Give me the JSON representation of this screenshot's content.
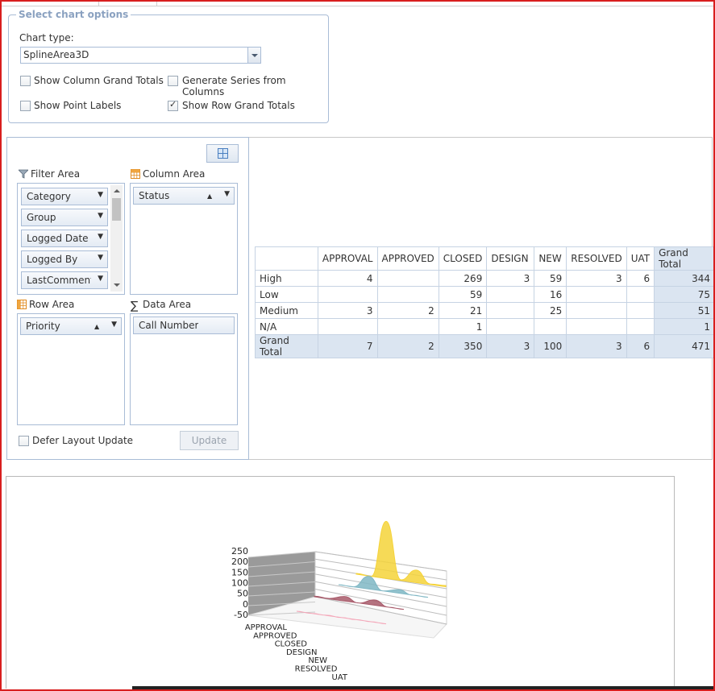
{
  "chart_options": {
    "legend": "Select chart options",
    "chart_type_label": "Chart type:",
    "chart_type_value": "SplineArea3D",
    "checkboxes": [
      {
        "label": "Show Column Grand Totals",
        "checked": false
      },
      {
        "label": "Generate Series from Columns",
        "checked": false
      },
      {
        "label": "Show Point Labels",
        "checked": false
      },
      {
        "label": "Show Row Grand Totals",
        "checked": true
      }
    ]
  },
  "field_list": {
    "filter_area": {
      "title": "Filter Area",
      "fields": [
        "Category",
        "Group",
        "Logged Date",
        "Logged By",
        "LastCommentT"
      ]
    },
    "column_area": {
      "title": "Column Area",
      "fields": [
        "Status"
      ]
    },
    "row_area": {
      "title": "Row Area",
      "fields": [
        "Priority"
      ]
    },
    "data_area": {
      "title": "Data Area",
      "fields": [
        "Call Number"
      ]
    },
    "defer_label": "Defer Layout Update",
    "update_label": "Update"
  },
  "pivot": {
    "columns": [
      "APPROVAL",
      "APPROVED",
      "CLOSED",
      "DESIGN",
      "NEW",
      "RESOLVED",
      "UAT",
      "Grand Total"
    ],
    "rows": [
      {
        "label": "High",
        "cells": [
          "4",
          "",
          "269",
          "3",
          "59",
          "3",
          "6",
          "344"
        ]
      },
      {
        "label": "Low",
        "cells": [
          "",
          "",
          "59",
          "",
          "16",
          "",
          "",
          "75"
        ]
      },
      {
        "label": "Medium",
        "cells": [
          "3",
          "2",
          "21",
          "",
          "25",
          "",
          "",
          "51"
        ]
      },
      {
        "label": "N/A",
        "cells": [
          "",
          "",
          "1",
          "",
          "",
          "",
          "",
          "1"
        ]
      },
      {
        "label": "Grand Total",
        "cells": [
          "7",
          "2",
          "350",
          "3",
          "100",
          "3",
          "6",
          "471"
        ]
      }
    ]
  },
  "chart_data": {
    "type": "area",
    "subtype": "SplineArea3D",
    "title": "",
    "xlabel": "",
    "ylabel": "",
    "categories": [
      "APPROVAL",
      "APPROVED",
      "CLOSED",
      "DESIGN",
      "NEW",
      "RESOLVED",
      "UAT"
    ],
    "y_ticks": [
      "250",
      "200",
      "150",
      "100",
      "50",
      "0",
      "-50"
    ],
    "ylim": [
      -50,
      250
    ],
    "series": [
      {
        "values": [
          4,
          0,
          269,
          3,
          59,
          3,
          6
        ],
        "color": "#f5d33a"
      },
      {
        "values": [
          0,
          0,
          59,
          0,
          16,
          0,
          0
        ],
        "color": "#7fb7c4"
      },
      {
        "values": [
          3,
          2,
          21,
          0,
          25,
          0,
          0
        ],
        "color": "#a85a6a"
      },
      {
        "values": [
          0,
          0,
          1,
          0,
          0,
          0,
          0
        ],
        "color": "#f4a7b9"
      }
    ]
  }
}
